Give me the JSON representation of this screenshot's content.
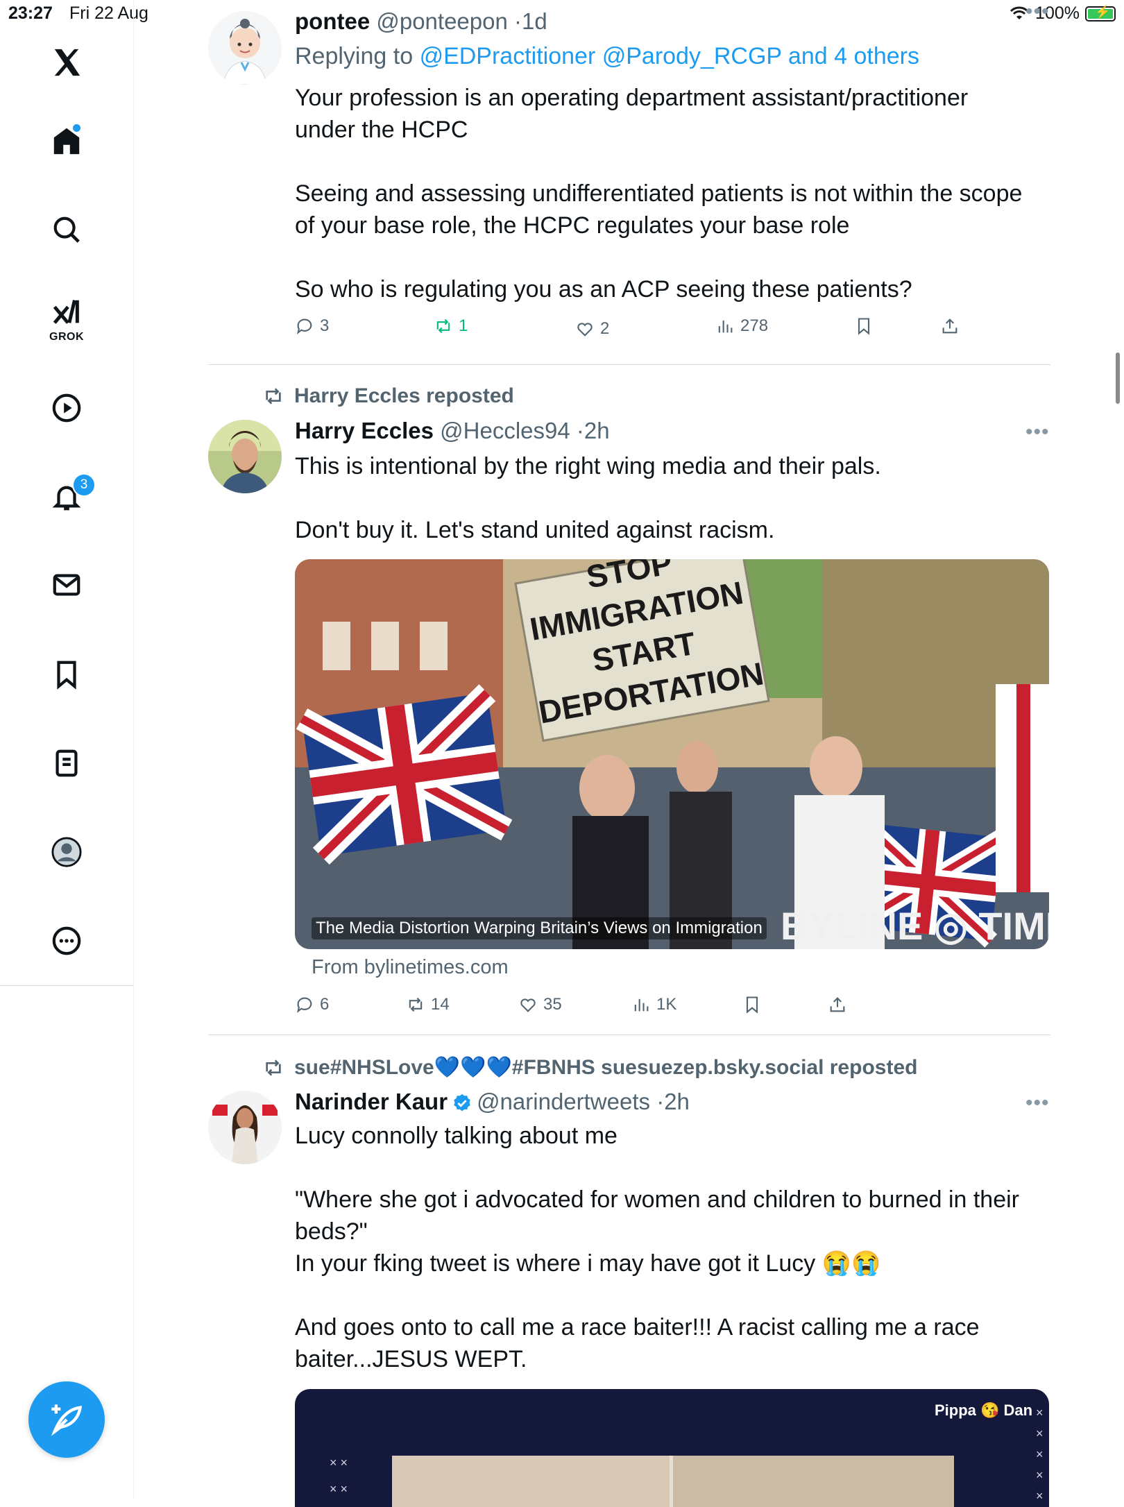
{
  "status_bar": {
    "time": "23:27",
    "date": "Fri 22 Aug",
    "battery": "100%"
  },
  "sidebar": {
    "logo": "x-logo",
    "items": [
      {
        "name": "home",
        "icon": "home-icon",
        "badge_dot": true
      },
      {
        "name": "explore",
        "icon": "search-icon"
      },
      {
        "name": "grok",
        "icon": "grok-icon",
        "label": "GROK"
      },
      {
        "name": "video",
        "icon": "play-icon"
      },
      {
        "name": "notifications",
        "icon": "bell-icon",
        "badge": "3"
      },
      {
        "name": "messages",
        "icon": "mail-icon"
      },
      {
        "name": "bookmarks",
        "icon": "bookmark-icon"
      },
      {
        "name": "lists",
        "icon": "list-icon"
      },
      {
        "name": "profile",
        "icon": "avatar-icon"
      },
      {
        "name": "more",
        "icon": "more-icon"
      }
    ],
    "compose": "compose-icon"
  },
  "tweets": [
    {
      "name": "pontee",
      "handle": "@ponteepon",
      "time": "1d",
      "reply_prefix": "Replying to",
      "reply_to": "@EDPractitioner @Parody_RCGP and 4 others",
      "text": "Your profession is an operating department assistant/practitioner\nunder the HCPC\n\nSeeing and assessing undifferentiated patients is not within the scope\nof your base role, the HCPC regulates your base role\n\nSo who is regulating you as an ACP seeing these patients?",
      "replies": "3",
      "reposts": "1",
      "likes": "2",
      "views": "278"
    },
    {
      "reposted_by": "Harry Eccles reposted",
      "name": "Harry Eccles",
      "handle": "@Heccles94",
      "time": "2h",
      "text": "This is intentional by the right wing media and their pals.\n\nDon't buy it. Let's stand united against racism.",
      "card": {
        "sign_text": "STOP IMMIGRATION START DEPORTATION",
        "caption": "The Media Distortion Warping Britain’s Views on Immigration",
        "brand": "BYLINE TIMES",
        "source": "From bylinetimes.com"
      },
      "replies": "6",
      "reposts": "14",
      "likes": "35",
      "views": "1K"
    },
    {
      "reposted_by": "sue#NHSLove💙💙💙#FBNHS suesuezep.bsky.social reposted",
      "name": "Narinder Kaur",
      "handle": "@narindertweets",
      "time": "2h",
      "text": "Lucy connolly talking about me\n\n\"Where she got i advocated for women and children to burned in their\nbeds?\"\nIn your fking tweet is where i may have got it Lucy 😭😭\n\nAnd goes onto to call me a race baiter!!! A racist calling me a race\nbaiter...JESUS WEPT.",
      "media_label": "Pippa 😘 Dan"
    }
  ],
  "colors": {
    "accent": "#1d9bf0",
    "repost_green": "#00ba7c",
    "muted": "#536471"
  }
}
